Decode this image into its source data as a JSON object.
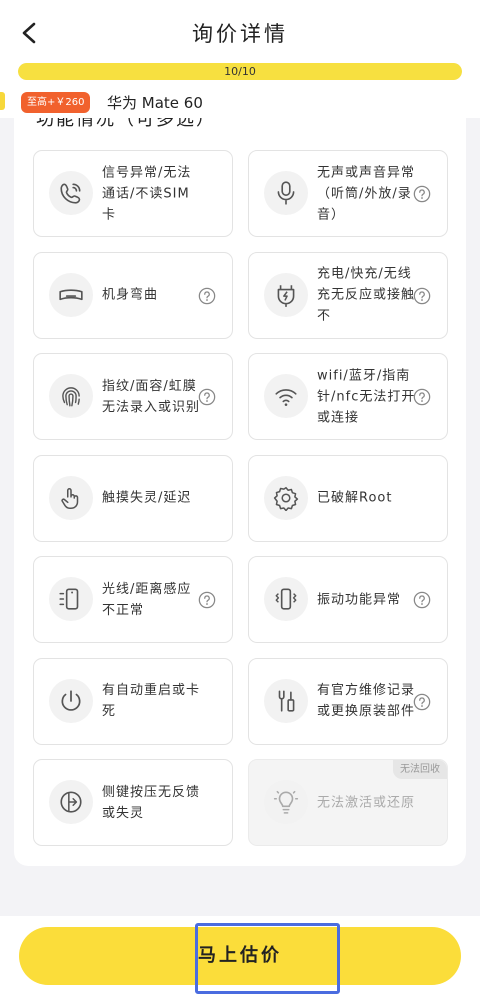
{
  "header": {
    "title": "询价详情"
  },
  "progress": {
    "text": "10/10",
    "fraction": 1.0
  },
  "product": {
    "badge": "至高+￥260",
    "name": "华为 Mate 60"
  },
  "section": {
    "title": "功能情况（可多选）"
  },
  "cards": [
    {
      "label": "信号异常/无法通话/不读SIM卡",
      "icon": "phone-icon",
      "help": false,
      "disabled": false
    },
    {
      "label": "无声或声音异常（听筒/外放/录音）",
      "icon": "microphone-icon",
      "help": true,
      "disabled": false
    },
    {
      "label": "机身弯曲",
      "icon": "bent-phone-icon",
      "help": true,
      "disabled": false
    },
    {
      "label": "充电/快充/无线充无反应或接触不",
      "icon": "charging-icon",
      "help": true,
      "disabled": false
    },
    {
      "label": "指纹/面容/虹膜无法录入或识别",
      "icon": "fingerprint-icon",
      "help": true,
      "disabled": false
    },
    {
      "label": "wifi/蓝牙/指南针/nfc无法打开或连接",
      "icon": "wifi-icon",
      "help": true,
      "disabled": false
    },
    {
      "label": "触摸失灵/延迟",
      "icon": "touch-icon",
      "help": false,
      "disabled": false
    },
    {
      "label": "已破解Root",
      "icon": "gear-icon",
      "help": false,
      "disabled": false
    },
    {
      "label": "光线/距离感应不正常",
      "icon": "light-sensor-icon",
      "help": true,
      "disabled": false
    },
    {
      "label": "振动功能异常",
      "icon": "vibration-icon",
      "help": true,
      "disabled": false
    },
    {
      "label": "有自动重启或卡死",
      "icon": "power-icon",
      "help": false,
      "disabled": false
    },
    {
      "label": "有官方维修记录或更换原装部件",
      "icon": "tools-icon",
      "help": true,
      "disabled": false
    },
    {
      "label": "侧键按压无反馈或失灵",
      "icon": "side-button-icon",
      "help": false,
      "disabled": false
    },
    {
      "label": "无法激活或还原",
      "icon": "lightbulb-icon",
      "help": false,
      "disabled": true,
      "tag": "无法回收"
    }
  ],
  "footer": {
    "submit_label": "马上估价"
  },
  "colors": {
    "accent_yellow": "#fbdd3a",
    "badge_orange": "#f1612d",
    "focus_blue": "#4a6ce0"
  }
}
